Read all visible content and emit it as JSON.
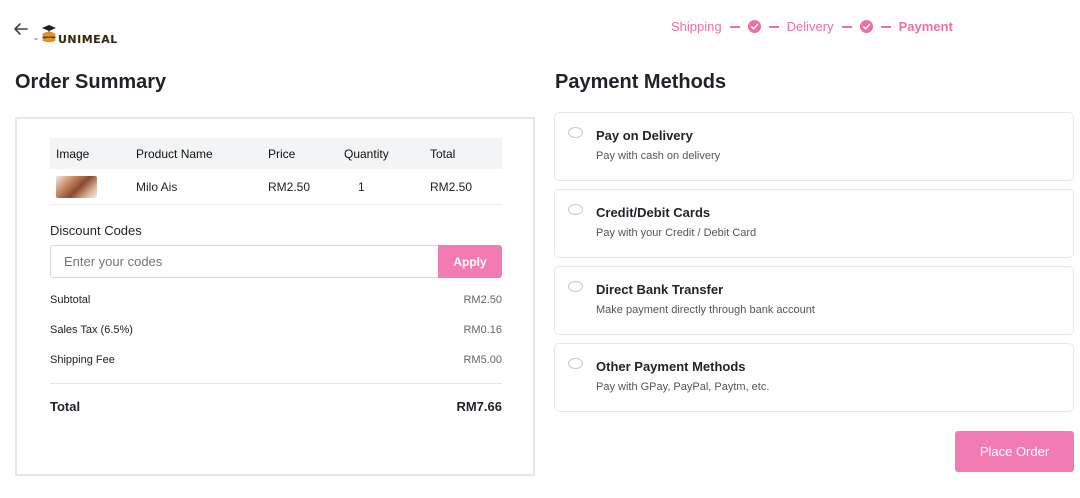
{
  "header": {
    "back_icon": "arrow-left-icon",
    "logo_prefix": "-",
    "logo_text": "UNIMEAL",
    "logo_icon": "graduation-cap-burger-icon"
  },
  "stepper": {
    "steps": [
      "Shipping",
      "Delivery",
      "Payment"
    ],
    "accent_color": "#ec6fa9"
  },
  "order_summary": {
    "title": "Order Summary",
    "table": {
      "headers": [
        "Image",
        "Product Name",
        "Price",
        "Quantity",
        "Total"
      ],
      "rows": [
        {
          "image": "milo-ais-photo",
          "name": "Milo Ais",
          "price": "RM2.50",
          "quantity": "1",
          "total": "RM2.50"
        }
      ]
    },
    "discount": {
      "label": "Discount Codes",
      "placeholder": "Enter your codes",
      "apply_label": "Apply"
    },
    "lines": [
      {
        "label": "Subtotal",
        "value": "RM2.50"
      },
      {
        "label": "Sales Tax (6.5%)",
        "value": "RM0.16"
      },
      {
        "label": "Shipping Fee",
        "value": "RM5.00"
      }
    ],
    "total": {
      "label": "Total",
      "value": "RM7.66"
    }
  },
  "payment": {
    "title": "Payment Methods",
    "methods": [
      {
        "title": "Pay on Delivery",
        "desc": "Pay with cash on delivery"
      },
      {
        "title": "Credit/Debit Cards",
        "desc": "Pay with your Credit / Debit Card"
      },
      {
        "title": "Direct Bank Transfer",
        "desc": "Make payment directly through bank account"
      },
      {
        "title": "Other Payment Methods",
        "desc": "Pay with GPay, PayPal, Paytm, etc."
      }
    ],
    "place_order_label": "Place Order",
    "button_color": "#f37bb4"
  }
}
